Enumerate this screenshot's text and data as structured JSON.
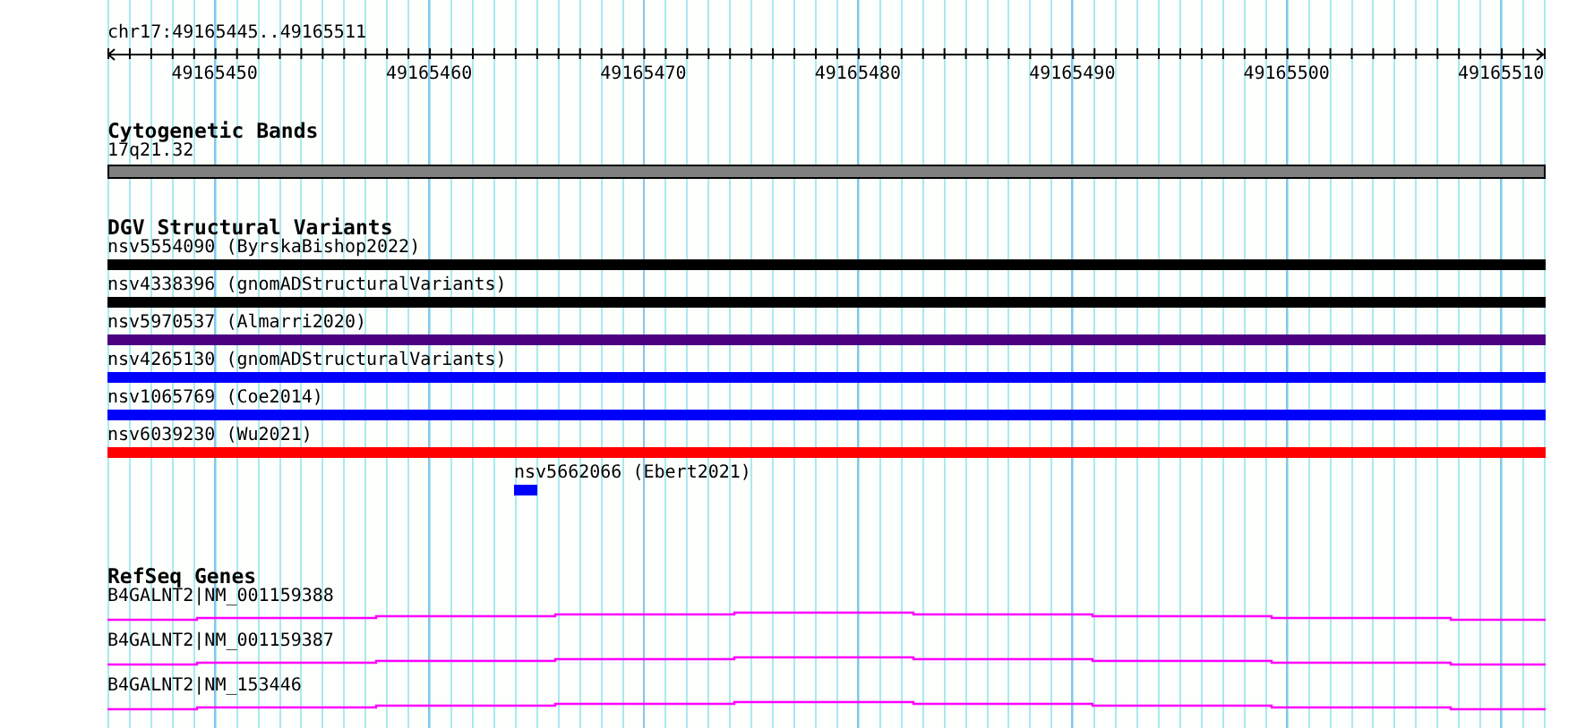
{
  "ruler": {
    "range": "chr17:49165445..49165511",
    "ticks": [
      "49165450",
      "49165460",
      "49165470",
      "49165480",
      "49165490",
      "49165500",
      "49165510"
    ]
  },
  "tracks": [
    {
      "kind": "cytoband",
      "title": "Cytogenetic Bands",
      "items": [
        {
          "label": "17q21.32"
        }
      ]
    },
    {
      "kind": "variants",
      "title": "DGV Structural Variants",
      "items": [
        {
          "label": "nsv5554090 (ByrskaBishop2022)",
          "color": "#000000",
          "kind": "full"
        },
        {
          "label": "nsv4338396 (gnomADStructuralVariants)",
          "color": "#000000",
          "kind": "full"
        },
        {
          "label": "nsv5970537 (Almarri2020)",
          "color": "#4b0082",
          "kind": "full"
        },
        {
          "label": "nsv4265130 (gnomADStructuralVariants)",
          "color": "#0000ff",
          "kind": "full"
        },
        {
          "label": "nsv1065769 (Coe2014)",
          "color": "#0000ff",
          "kind": "full"
        },
        {
          "label": "nsv6039230 (Wu2021)",
          "color": "#ff0000",
          "kind": "full"
        },
        {
          "label": "nsv5662066 (Ebert2021)",
          "color": "#0000ff",
          "kind": "partial"
        }
      ]
    },
    {
      "kind": "genes",
      "title": "RefSeq Genes",
      "items": [
        {
          "label": "B4GALNT2|NM_001159388"
        },
        {
          "label": "B4GALNT2|NM_001159387"
        },
        {
          "label": "B4GALNT2|NM_153446"
        }
      ]
    }
  ]
}
